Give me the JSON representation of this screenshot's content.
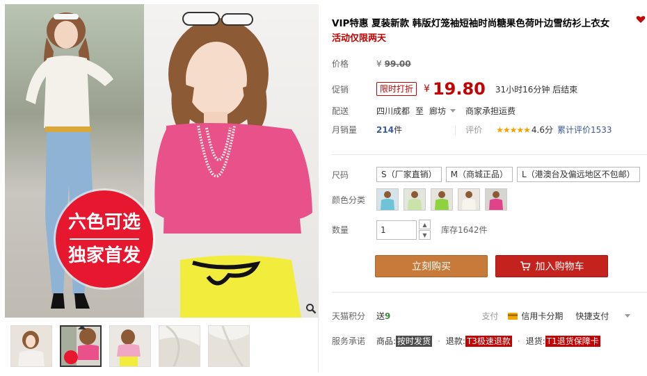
{
  "product": {
    "title": "VIP特惠 夏装新款 韩版灯笼袖短袖时尚糖果色荷叶边雪纺衫上衣女",
    "subtitle": "活动仅限两天"
  },
  "gallery": {
    "promo_line1": "六色可选",
    "promo_line2": "独家首发"
  },
  "price": {
    "label": "价格",
    "currency": "¥",
    "original": "99.00"
  },
  "promo": {
    "label": "促销",
    "tag": "限时打折",
    "currency": "¥",
    "price": "19.80",
    "countdown": "31小时16分钟 后结束"
  },
  "shipping": {
    "label": "配送",
    "from": "四川成都",
    "to_word": "至",
    "to": "廊坊",
    "fee": "商家承担运费"
  },
  "sales": {
    "label": "月销量",
    "count": "214",
    "unit": "件",
    "rating_label": "评价",
    "stars": "★★★★★",
    "score": "4.6分",
    "total_reviews": "累计评价1533"
  },
  "size": {
    "label": "尺码",
    "options": [
      "S（厂家直销）",
      "M（商城正品）",
      "L（港澳台及偏远地区不包邮）"
    ]
  },
  "color": {
    "label": "颜色分类",
    "swatches": [
      "#6fc3d9",
      "#c9e3a8",
      "#8ed23f",
      "#f2efe6",
      "#e0438a"
    ]
  },
  "quantity": {
    "label": "数量",
    "value": "1",
    "stock": "库存1642件"
  },
  "actions": {
    "buy_now": "立刻购买",
    "add_cart": "加入购物车"
  },
  "points": {
    "label": "天猫积分",
    "send": "送",
    "value": "9",
    "pay_label": "支付",
    "credit": "信用卡分期",
    "quick": "快捷支付"
  },
  "service": {
    "label": "服务承诺",
    "goods": "商品:",
    "goods_tag": "按时发货",
    "refund": "退款:",
    "refund_tag": "T3极速退款",
    "returns": "退货:",
    "returns_tag": "T1退货保障卡"
  },
  "colors": {
    "price_red": "#c40000",
    "buy_orange": "#c87a3a",
    "cart_red": "#c4221c",
    "promo_circle": "#e6172f",
    "link_blue": "#3c5a99"
  }
}
